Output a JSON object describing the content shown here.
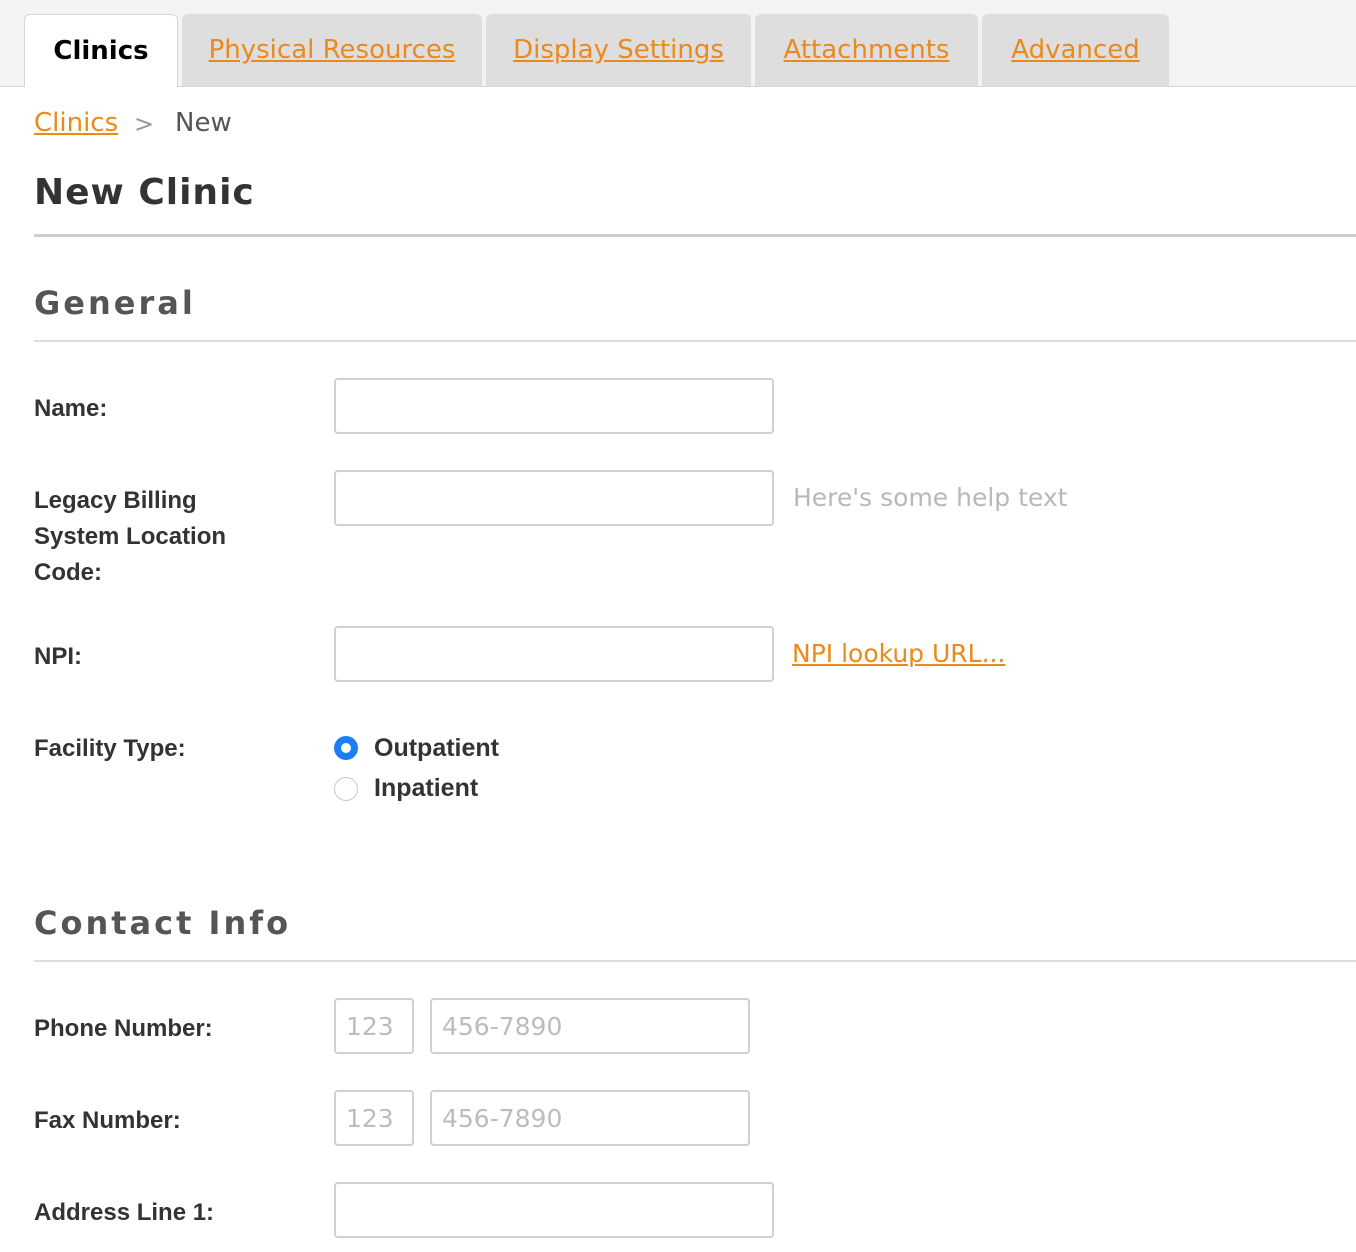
{
  "tabs": [
    {
      "label": "Clinics",
      "active": true
    },
    {
      "label": "Physical Resources",
      "active": false
    },
    {
      "label": "Display Settings",
      "active": false
    },
    {
      "label": "Attachments",
      "active": false
    },
    {
      "label": "Advanced",
      "active": false
    }
  ],
  "breadcrumb": {
    "parent": "Clinics",
    "separator": ">",
    "current": "New"
  },
  "page_title": "New Clinic",
  "general": {
    "title": "General",
    "name": {
      "label": "Name:",
      "value": ""
    },
    "legacy": {
      "label_lines": [
        "Legacy Billing",
        "System Location",
        "Code:"
      ],
      "value": "",
      "help": "Here's some help text"
    },
    "npi": {
      "label": "NPI:",
      "value": "",
      "link": "NPI lookup URL..."
    },
    "facility": {
      "label": "Facility Type:",
      "options": [
        "Outpatient",
        "Inpatient"
      ],
      "selected": "Outpatient"
    }
  },
  "contact": {
    "title": "Contact Info",
    "phone": {
      "label": "Phone Number:",
      "area_placeholder": "123",
      "number_placeholder": "456-7890"
    },
    "fax": {
      "label": "Fax Number:",
      "area_placeholder": "123",
      "number_placeholder": "456-7890"
    },
    "address1": {
      "label": "Address Line 1:",
      "value": ""
    }
  },
  "colors": {
    "accent": "#ea8a1c",
    "radio_selected": "#1a7ff5"
  }
}
